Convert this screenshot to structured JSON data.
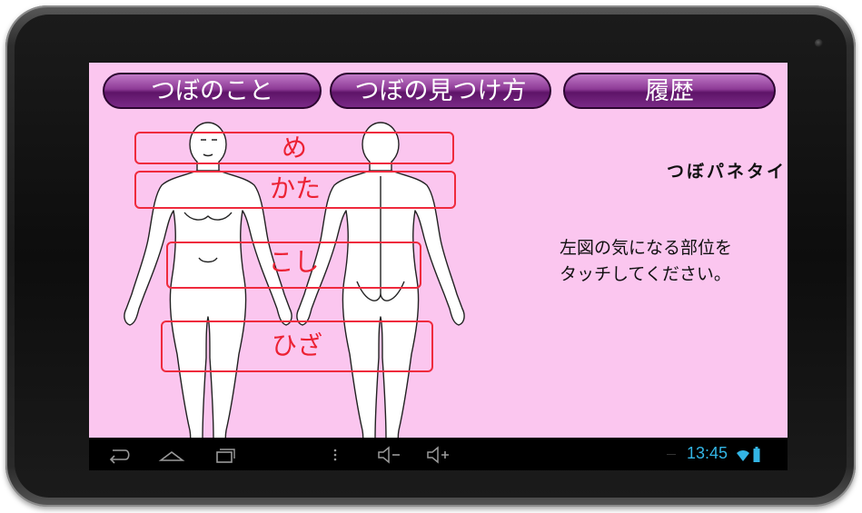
{
  "tabs": [
    {
      "label": "つぼのこと"
    },
    {
      "label": "つぼの見つけ方"
    },
    {
      "label": "履歴"
    }
  ],
  "body_regions": [
    {
      "label": "め"
    },
    {
      "label": "かた"
    },
    {
      "label": "こし"
    },
    {
      "label": "ひざ"
    }
  ],
  "brand": "つぼパネタイ",
  "instruction": {
    "line1": "左図の気になる部位を",
    "line2": "タッチしてください。"
  },
  "statusbar": {
    "time": "13:45"
  },
  "colors": {
    "screen_bg": "#fbc6ef",
    "tab_purple": "#7a2a86",
    "region_red": "#ef2a3d",
    "clock_blue": "#33b5e5"
  },
  "icons": [
    "back-icon",
    "home-icon",
    "recent-apps-icon",
    "menu-icon",
    "volume-down-icon",
    "volume-up-icon",
    "wifi-icon",
    "battery-icon"
  ]
}
